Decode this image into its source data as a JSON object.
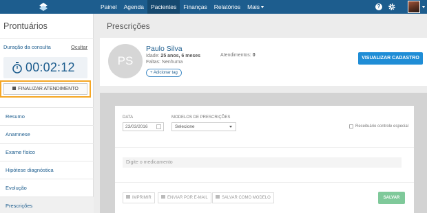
{
  "nav": {
    "items": [
      {
        "label": "Painel",
        "active": false
      },
      {
        "label": "Agenda",
        "active": false
      },
      {
        "label": "Pacientes",
        "active": true
      },
      {
        "label": "Finanças",
        "active": false
      },
      {
        "label": "Relatórios",
        "active": false
      },
      {
        "label": "Mais",
        "active": false
      }
    ],
    "help_label": "?"
  },
  "sidebar": {
    "title": "Prontuários",
    "duration_label": "Duração da consulta",
    "hide_label": "Ocultar",
    "timer": "00:02:12",
    "finish_label": "FINALIZAR ATENDIMENTO",
    "menu": [
      "Resumo",
      "Anamnese",
      "Exame físico",
      "Hipótese diagnóstica",
      "Evolução",
      "Prescrições"
    ],
    "active_menu": "Prescrições"
  },
  "page": {
    "title": "Prescrições"
  },
  "patient": {
    "initials": "PS",
    "name": "Paulo Silva",
    "age_label": "Idade:",
    "age_value": "25 anos, 6 meses",
    "faltas_label": "Faltas:",
    "faltas_value": "Nenhuma",
    "tag_label": "+ Adicionar tag",
    "atend_label": "Atendimentos:",
    "atend_value": "0",
    "view_button": "VISUALIZAR CADASTRO"
  },
  "form": {
    "date_label": "DATA",
    "date_value": "23/03/2016",
    "models_label": "MODELOS DE PRESCRIÇÕES",
    "models_value": "Selecione",
    "special_label": "Receituário controle especial",
    "med_placeholder": "Digite o medicamento",
    "print_label": "IMPRIMIR",
    "email_label": "ENVIAR POR E-MAIL",
    "model_save_label": "SALVAR COMO MODELO",
    "save_label": "SALVAR"
  },
  "colors": {
    "primary": "#1d5d8e",
    "accent": "#1f8dd6",
    "highlight": "#f5a623",
    "save": "#7fc99a"
  }
}
